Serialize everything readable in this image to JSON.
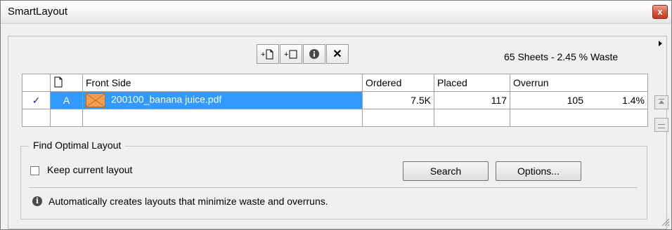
{
  "window": {
    "title": "SmartLayout",
    "close_label": "x"
  },
  "toolbar": {
    "buttons": [
      {
        "name": "add-page",
        "label": "+"
      },
      {
        "name": "add-sheet",
        "label": "+"
      },
      {
        "name": "info",
        "label": "i"
      },
      {
        "name": "delete",
        "label": "✕"
      }
    ]
  },
  "summary": "65 Sheets - 2.45 % Waste",
  "table": {
    "columns": [
      "",
      "",
      "Front Side",
      "Ordered",
      "Placed",
      "Overrun",
      ""
    ],
    "rows": [
      {
        "check": "✓",
        "id": "A",
        "front_side": "200100_banana juice.pdf",
        "ordered": "7.5K",
        "placed": "117",
        "overrun": "105",
        "overrun_pct": "1.4%"
      }
    ]
  },
  "find_optimal": {
    "label": "Find Optimal Layout",
    "keep_current_label": "Keep current layout",
    "keep_current_checked": false,
    "search_label": "Search",
    "options_label": "Options...",
    "info_text": "Automatically creates layouts that minimize waste and overruns."
  },
  "colors": {
    "selection": "#3399ff",
    "close": "#d8543a",
    "thumb": "#f0a050"
  }
}
